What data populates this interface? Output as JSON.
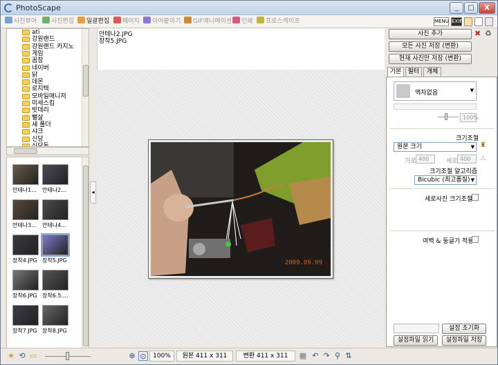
{
  "window": {
    "title": "PhotoScape",
    "buttons": [
      "_",
      "□",
      "X"
    ]
  },
  "tabs": [
    {
      "label": "사진뷰어",
      "active": false,
      "color": "#7a9ed6"
    },
    {
      "label": "사진편집",
      "active": false,
      "color": "#6fb36a"
    },
    {
      "label": "일괄편집",
      "active": true,
      "color": "#e0a040"
    },
    {
      "label": "페이지",
      "active": false,
      "color": "#d65b5b"
    },
    {
      "label": "이어붙이기",
      "active": false,
      "color": "#8a7ad0"
    },
    {
      "label": "GIF애니메이션",
      "active": false,
      "color": "#c98a3a"
    },
    {
      "label": "인쇄",
      "active": false,
      "color": "#d45a8a"
    },
    {
      "label": "프로스케이프",
      "active": false,
      "color": "#c2b43a"
    }
  ],
  "tab_right_icons": {
    "menu": "MENU",
    "exif": "EXIF"
  },
  "tree": {
    "items": [
      "ati",
      "강원랜드",
      "강원랜드 카지노",
      "게임",
      "꼼창",
      "네이버",
      "닭",
      "데몬",
      "로지텍",
      "모바일매니저",
      "미세스킴",
      "빗데리",
      "뻘살",
      "새 폴더",
      "샤크",
      "신당",
      "신당동"
    ]
  },
  "thumbnails": [
    {
      "label": "안테나1..."
    },
    {
      "label": "안테나2..."
    },
    {
      "label": "안테나3..."
    },
    {
      "label": "안테나4..."
    },
    {
      "label": "장착4.JPG"
    },
    {
      "label": "장착5.JPG",
      "selected": true
    },
    {
      "label": "장착6.JPG"
    },
    {
      "label": "장착6.5...."
    },
    {
      "label": "장착7.JPG"
    },
    {
      "label": "장착8.JPG"
    }
  ],
  "files": [
    "안테나2.JPG",
    "장착5.JPG"
  ],
  "photo": {
    "date_stamp": "2009.09.09"
  },
  "status": {
    "zoom": "100%",
    "original": "원본 411 x 311",
    "converted": "변환 411 x 311"
  },
  "right": {
    "add_photo": "사진 추가",
    "save_all": "모든 사진 저장 (변환)",
    "save_current": "현재 사진만 저장 (변환)",
    "tabs": [
      "기본",
      "필터",
      "개체"
    ],
    "frame_select": "액자없음",
    "frame_zoom": "100%",
    "resize_title": "크기조절",
    "resize_select": "원본 크기",
    "width_label": "가로",
    "width_value": "400",
    "height_label": "세로",
    "height_value": "400",
    "algorithm_title": "크기조절 알고리즘",
    "algorithm_select": "Bicubic (최고품질)",
    "vertical_resize": "세로사진 크기조절",
    "margin_round": "여백 & 둥글기 적용",
    "reset_settings": "설정 초기화",
    "load_settings": "설정파일 읽기",
    "save_settings": "설정파일 저장"
  }
}
